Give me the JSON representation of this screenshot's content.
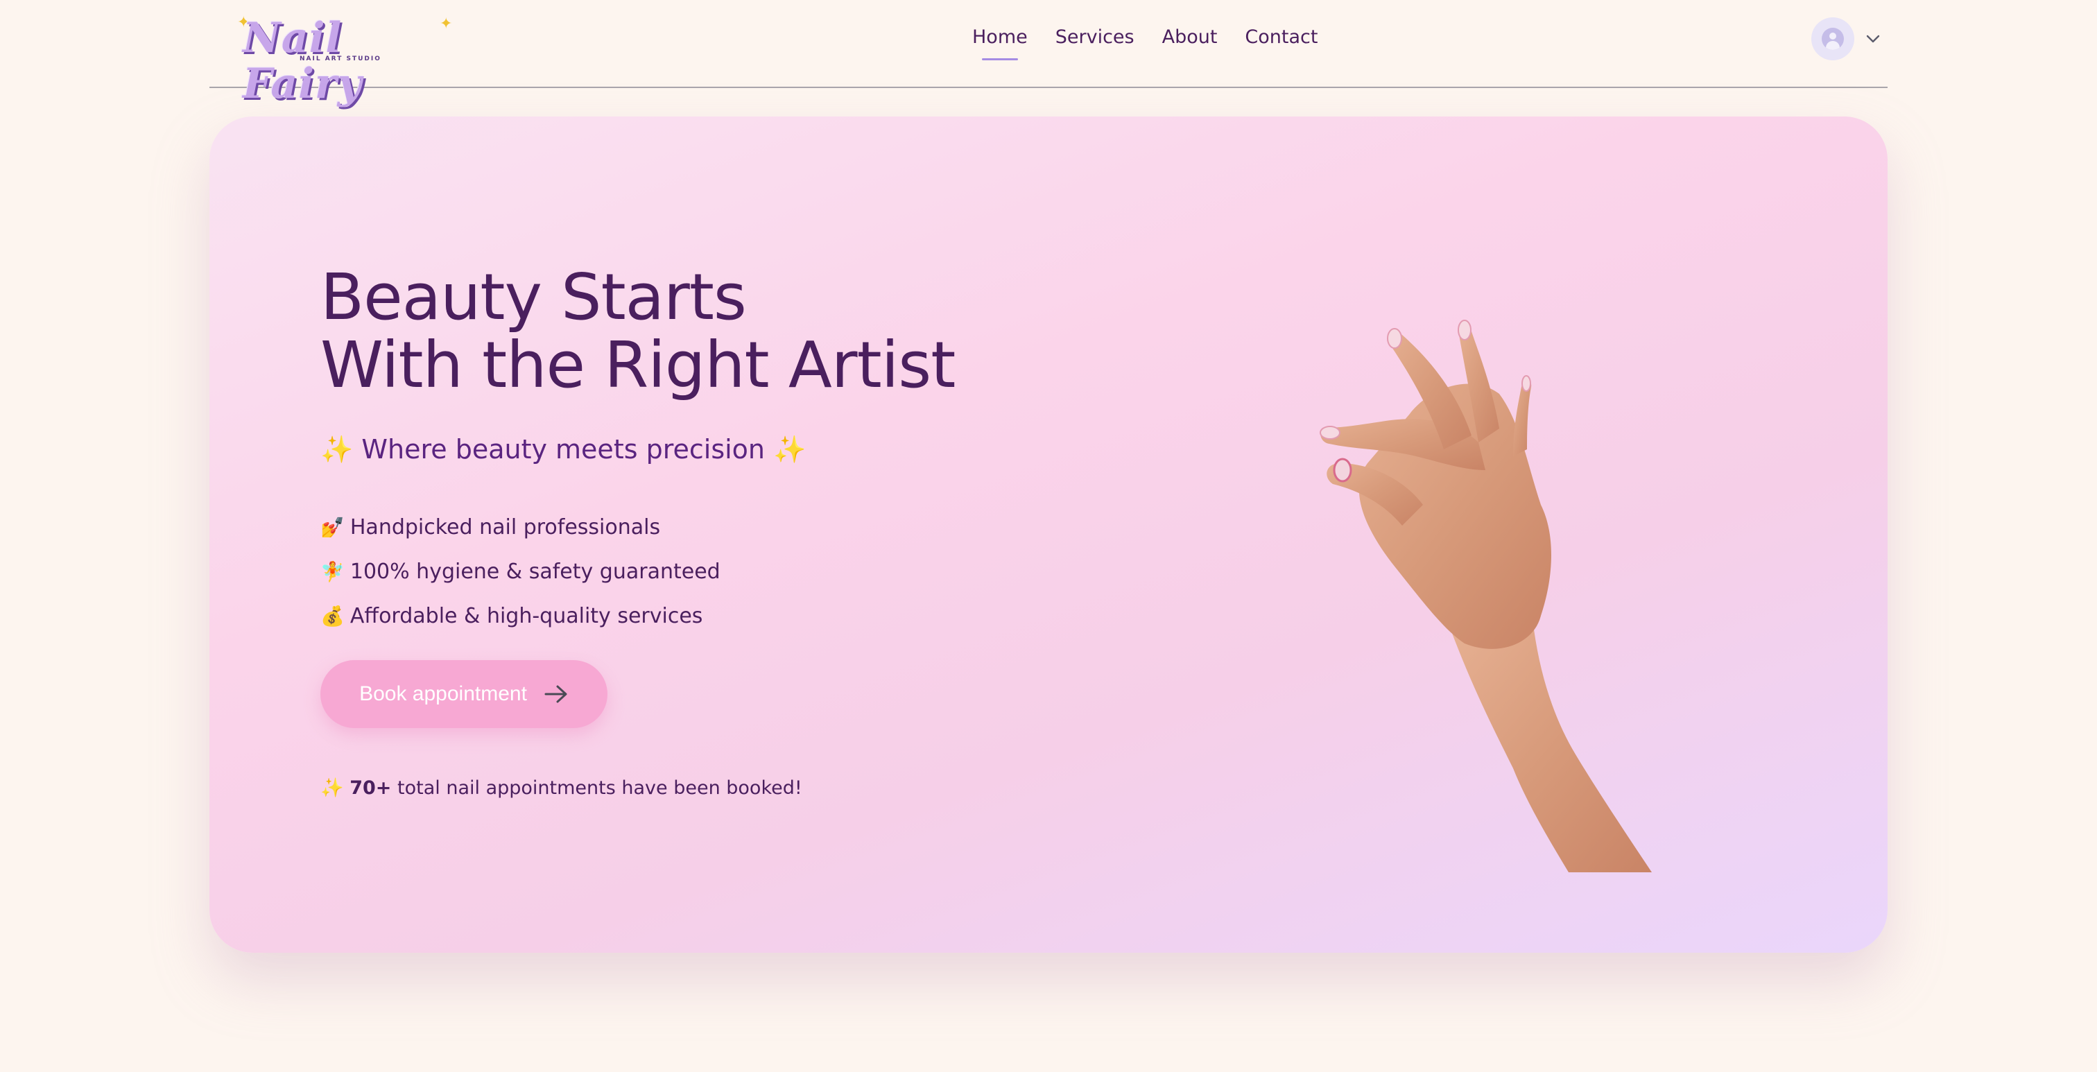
{
  "header": {
    "logo": {
      "text": "Nail Fairy",
      "subtext": "NAIL ART STUDIO"
    },
    "nav": [
      {
        "label": "Home",
        "active": true
      },
      {
        "label": "Services",
        "active": false
      },
      {
        "label": "About",
        "active": false
      },
      {
        "label": "Contact",
        "active": false
      }
    ],
    "account": {
      "avatar_icon": "user-icon",
      "menu_icon": "chevron-down-icon"
    }
  },
  "hero": {
    "title_line1": "Beauty Starts",
    "title_line2": "With the Right Artist",
    "tagline_spark": "✨",
    "tagline": "Where beauty meets precision",
    "features": [
      {
        "emoji": "💅",
        "text": "Handpicked nail professionals"
      },
      {
        "emoji": "🧚",
        "text": "100% hygiene & safety guaranteed"
      },
      {
        "emoji": "💰",
        "text": "Affordable & high-quality services"
      }
    ],
    "cta_label": "Book appointment",
    "cta_icon": "arrow-right-icon",
    "booked_spark": "✨",
    "booked_count": "70+",
    "booked_text": "total nail appointments have been booked!",
    "image_icon": "hand-ok-gesture-image"
  },
  "colors": {
    "background": "#fdf5ef",
    "primary_text": "#4a1f5e",
    "accent": "#a58be3",
    "button": "#f7a8d3"
  }
}
